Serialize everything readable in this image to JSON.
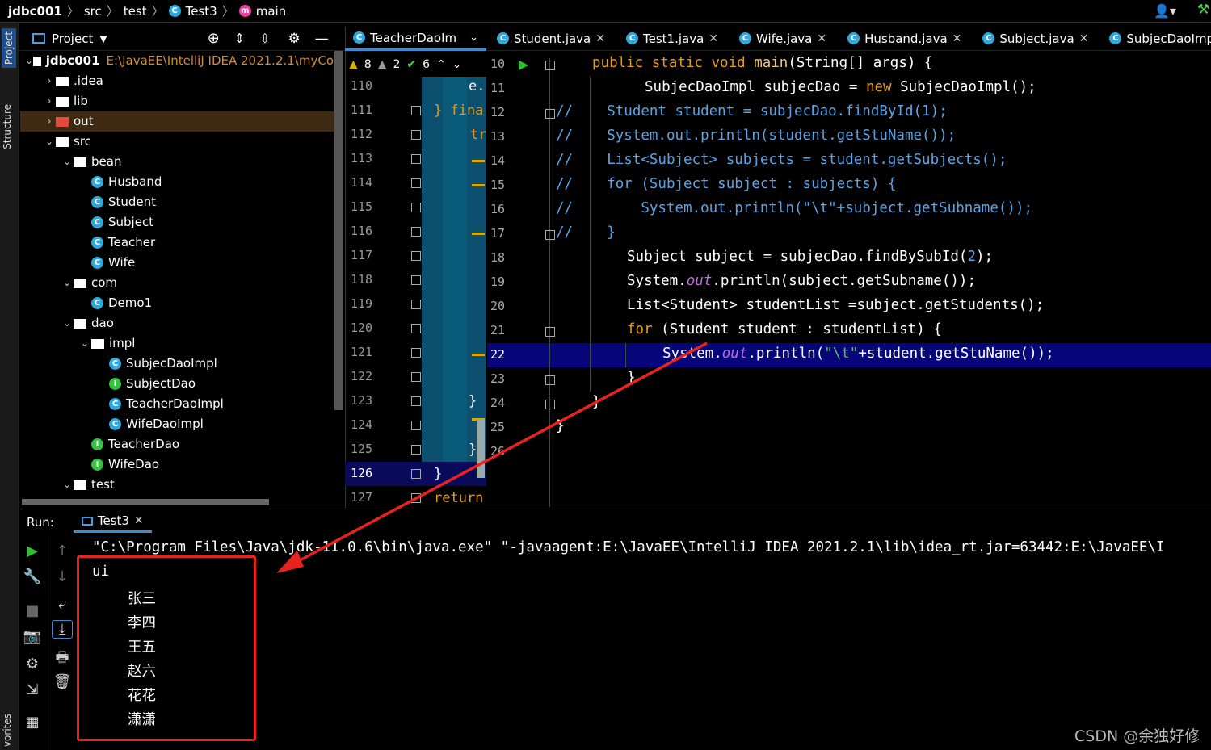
{
  "breadcrumb": {
    "project": "jdbc001",
    "src": "src",
    "test": "test",
    "file": "Test3",
    "method": "main"
  },
  "sidebar": {
    "project_tab": "Project",
    "structure_tab": "Structure",
    "favorites_tab": "vorites"
  },
  "project_panel": {
    "title": "Project",
    "root_name": "jdbc001",
    "root_path": "E:\\JavaEE\\IntelliJ IDEA 2021.2.1\\myCo",
    "items": [
      {
        "label": ".idea",
        "kind": "folder",
        "depth": 1,
        "open": false
      },
      {
        "label": "lib",
        "kind": "folder",
        "depth": 1,
        "open": false
      },
      {
        "label": "out",
        "kind": "folder-red",
        "depth": 1,
        "open": false
      },
      {
        "label": "src",
        "kind": "folder",
        "depth": 1,
        "open": true
      },
      {
        "label": "bean",
        "kind": "folder",
        "depth": 2,
        "open": true
      },
      {
        "label": "Husband",
        "kind": "class",
        "depth": 3
      },
      {
        "label": "Student",
        "kind": "class",
        "depth": 3
      },
      {
        "label": "Subject",
        "kind": "class",
        "depth": 3
      },
      {
        "label": "Teacher",
        "kind": "class",
        "depth": 3
      },
      {
        "label": "Wife",
        "kind": "class",
        "depth": 3
      },
      {
        "label": "com",
        "kind": "folder",
        "depth": 2,
        "open": true
      },
      {
        "label": "Demo1",
        "kind": "class",
        "depth": 3
      },
      {
        "label": "dao",
        "kind": "folder",
        "depth": 2,
        "open": true
      },
      {
        "label": "impl",
        "kind": "folder",
        "depth": 3,
        "open": true
      },
      {
        "label": "SubjecDaoImpl",
        "kind": "class",
        "depth": 4
      },
      {
        "label": "SubjectDao",
        "kind": "interface",
        "depth": 4
      },
      {
        "label": "TeacherDaoImpl",
        "kind": "class",
        "depth": 4
      },
      {
        "label": "WifeDaoImpl",
        "kind": "class",
        "depth": 4
      },
      {
        "label": "TeacherDao",
        "kind": "interface",
        "depth": 3
      },
      {
        "label": "WifeDao",
        "kind": "interface",
        "depth": 3
      },
      {
        "label": "test",
        "kind": "folder",
        "depth": 2,
        "open": true
      }
    ]
  },
  "editor_left": {
    "tab": "TeacherDaoIm",
    "warnings": "8",
    "weak_warnings": "2",
    "checks": "6",
    "line_numbers": [
      "110",
      "111",
      "112",
      "113",
      "114",
      "115",
      "116",
      "117",
      "118",
      "119",
      "120",
      "121",
      "122",
      "123",
      "124",
      "125",
      "126",
      "127"
    ],
    "fragments": {
      "l110": "e.",
      "l111": "} fina",
      "l112": "tr",
      "l123": "}",
      "l125": "}",
      "l126": "}",
      "l127": "return"
    }
  },
  "editor_tabs": [
    {
      "label": "Student.java"
    },
    {
      "label": "Test1.java"
    },
    {
      "label": "Wife.java"
    },
    {
      "label": "Husband.java"
    },
    {
      "label": "Subject.java"
    },
    {
      "label": "SubjecDaoImpl.jav"
    }
  ],
  "editor_right": {
    "line_numbers": [
      "10",
      "11",
      "12",
      "13",
      "14",
      "15",
      "16",
      "17",
      "18",
      "19",
      "20",
      "21",
      "22",
      "23",
      "24",
      "25",
      "26"
    ],
    "current_line": "22"
  },
  "run_panel": {
    "label": "Run:",
    "tab": "Test3",
    "command": "\"C:\\Program Files\\Java\\jdk-11.0.6\\bin\\java.exe\" \"-javaagent:E:\\JavaEE\\IntelliJ IDEA 2021.2.1\\lib\\idea_rt.jar=63442:E:\\JavaEE\\I",
    "output_first": "ui",
    "output_lines": [
      "张三",
      "李四",
      "王五",
      "赵六",
      "花花",
      "潇潇"
    ]
  },
  "watermark": "CSDN @余独好修",
  "colors": {
    "accent": "#3f8bd0",
    "keyword": "#e59a1a",
    "comment": "#5ca3e6",
    "highlight_box": "#e8231f",
    "current_line": "#06067a"
  }
}
